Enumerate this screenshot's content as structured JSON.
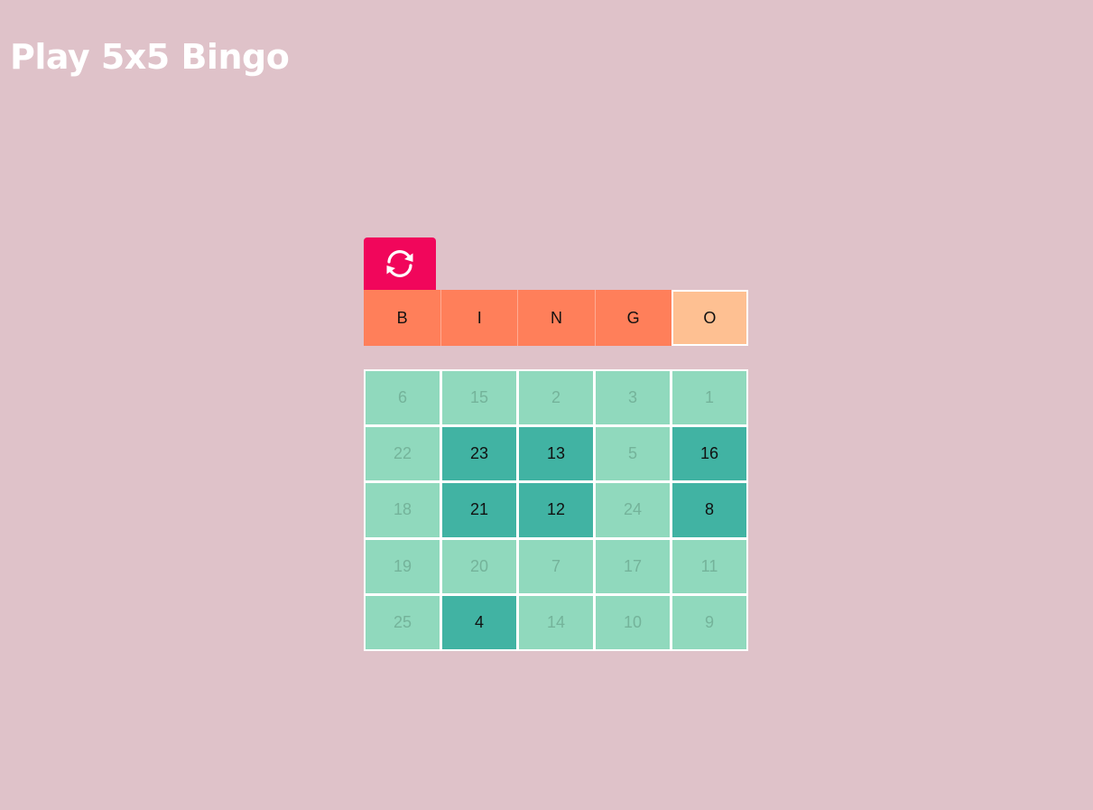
{
  "title": "Play 5x5 Bingo",
  "reset_button": {
    "icon": "refresh-icon"
  },
  "colors": {
    "background": "#dfc2c9",
    "button": "#f1065b",
    "header": "#ff7f5a",
    "header_lit": "#fec092",
    "cell": "#90d9bd",
    "cell_marked": "#41b3a3"
  },
  "header": {
    "letters": [
      {
        "label": "B",
        "lit": false
      },
      {
        "label": "I",
        "lit": false
      },
      {
        "label": "N",
        "lit": false
      },
      {
        "label": "G",
        "lit": false
      },
      {
        "label": "O",
        "lit": true
      }
    ]
  },
  "board": {
    "rows": [
      [
        {
          "value": "6",
          "marked": false
        },
        {
          "value": "15",
          "marked": false
        },
        {
          "value": "2",
          "marked": false
        },
        {
          "value": "3",
          "marked": false
        },
        {
          "value": "1",
          "marked": false
        }
      ],
      [
        {
          "value": "22",
          "marked": false
        },
        {
          "value": "23",
          "marked": true
        },
        {
          "value": "13",
          "marked": true
        },
        {
          "value": "5",
          "marked": false
        },
        {
          "value": "16",
          "marked": true
        }
      ],
      [
        {
          "value": "18",
          "marked": false
        },
        {
          "value": "21",
          "marked": true
        },
        {
          "value": "12",
          "marked": true
        },
        {
          "value": "24",
          "marked": false
        },
        {
          "value": "8",
          "marked": true
        }
      ],
      [
        {
          "value": "19",
          "marked": false
        },
        {
          "value": "20",
          "marked": false
        },
        {
          "value": "7",
          "marked": false
        },
        {
          "value": "17",
          "marked": false
        },
        {
          "value": "11",
          "marked": false
        }
      ],
      [
        {
          "value": "25",
          "marked": false
        },
        {
          "value": "4",
          "marked": true
        },
        {
          "value": "14",
          "marked": false
        },
        {
          "value": "10",
          "marked": false
        },
        {
          "value": "9",
          "marked": false
        }
      ]
    ]
  }
}
